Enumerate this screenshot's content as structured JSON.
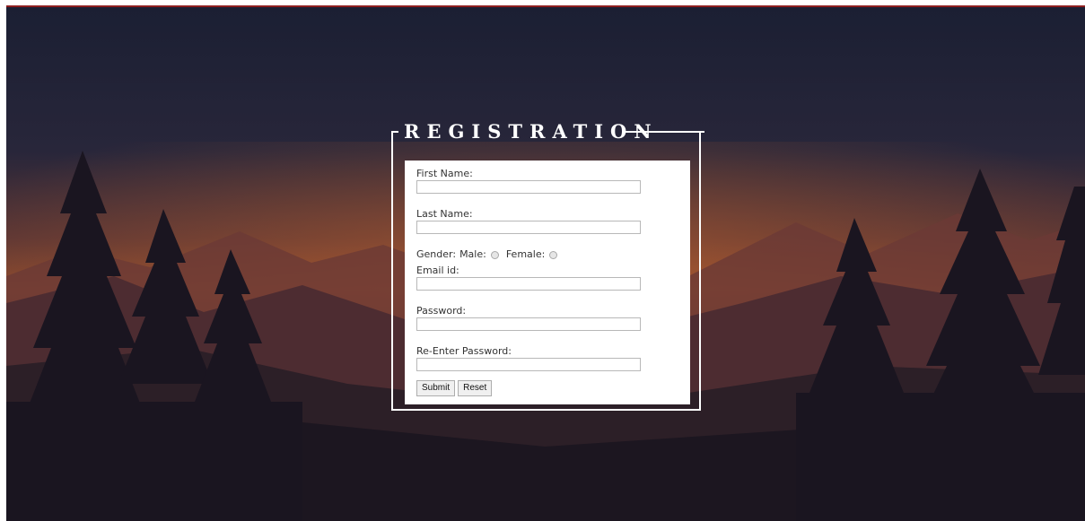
{
  "form": {
    "legend": "REGISTRATION",
    "first_name_label": "First Name:",
    "last_name_label": "Last Name:",
    "gender_label": "Gender:",
    "male_label": "Male:",
    "female_label": "Female:",
    "email_label": "Email id:",
    "password_label": "Password:",
    "reenter_password_label": "Re-Enter Password:",
    "submit_label": "Submit",
    "reset_label": "Reset"
  },
  "colors": {
    "sky_top": "#1d2035",
    "sky_glow": "#9a5430",
    "mountain": "#4a2a30",
    "tree": "#1a1622",
    "frame": "#ffffff",
    "top_border": "#8e1f1f"
  }
}
